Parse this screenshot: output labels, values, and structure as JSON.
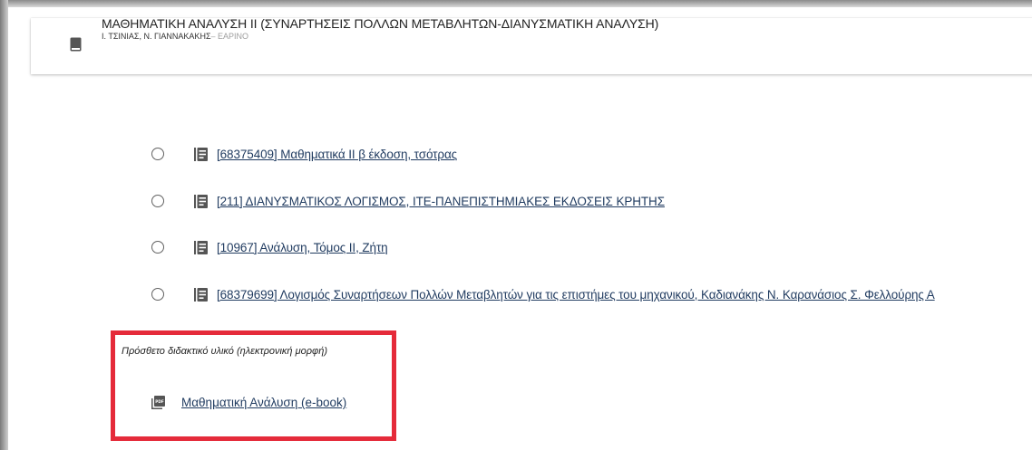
{
  "course": {
    "title": "ΜΑΘΗΜΑΤΙΚΗ ΑΝΑΛΥΣΗ ΙΙ (ΣΥΝΑΡΤΗΣΕΙΣ ΠΟΛΛΩΝ ΜΕΤΑΒΛΗΤΩΝ-ΔΙΑΝΥΣΜΑΤΙΚΗ ΑΝΑΛΥΣΗ)",
    "instructors": "Ι. ΤΣΙΝΙΑΣ, Ν. ΓΙΑΝΝΑΚΑΚΗΣ",
    "season": "– ΕΑΡΙΝΟ",
    "icon": "book-icon"
  },
  "books": [
    {
      "label": "[68375409] Μαθηματικά ΙΙ β έκδοση, τσότρας",
      "icon": "list-icon"
    },
    {
      "label": "[211] ΔΙΑΝΥΣΜΑΤΙΚΟΣ ΛΟΓΙΣΜΟΣ, ΙΤΕ-ΠΑΝΕΠΙΣΤΗΜΙΑΚΕΣ ΕΚΔΟΣΕΙΣ ΚΡΗΤΗΣ",
      "icon": "list-icon"
    },
    {
      "label": "[10967] Ανάλυση, Τόμος ΙΙ, Ζήτη",
      "icon": "list-icon"
    },
    {
      "label": "[68379699] Λογισμός Συναρτήσεων Πολλών Μεταβλητών για τις επιστήμες του μηχανικού, Καδιανάκης Ν. Καρανάσιος Σ. Φελλούρης Α",
      "icon": "list-icon"
    }
  ],
  "extra": {
    "label": "Πρόσθετο διδακτικό υλικό (ηλεκτρονική μορφή)",
    "ebook": "Μαθηματική Ανάλυση (e-book)",
    "icon": "pdf-icon"
  },
  "colors": {
    "link": "#1f3a5f",
    "highlight": "#e52b3a",
    "icon": "#616161"
  }
}
